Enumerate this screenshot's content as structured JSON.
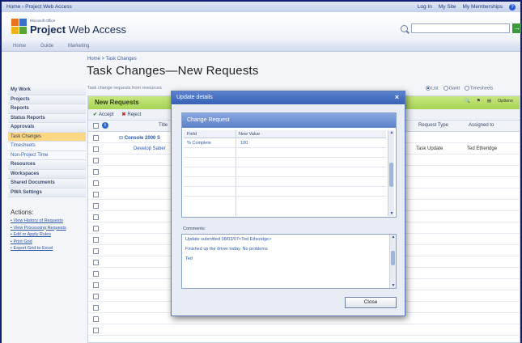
{
  "topbar": {
    "breadcrumb": "Home › Project Web Access",
    "login": "Log In",
    "my_site": "My Site",
    "my_memberships": "My Memberships"
  },
  "brand": {
    "small": "Microsoft Office",
    "title_bold": "Project",
    "title_rest": " Web Access",
    "logo_colors": [
      "#e8731c",
      "#3a70c6",
      "#f0b21c",
      "#5aa339"
    ]
  },
  "search": {
    "placeholder": "",
    "go_label": "→"
  },
  "nav_tabs": [
    "Home",
    "Guide",
    "Marketing"
  ],
  "page": {
    "breadcrumb": "Home > Task Changes",
    "title": "Task Changes—New Requests",
    "subtitle": "Task change requests from resources"
  },
  "views": {
    "list": "List",
    "gantt": "Gantt",
    "timesheets": "Timesheets"
  },
  "sidebar": {
    "items": [
      {
        "label": "My Work",
        "type": "section"
      },
      {
        "label": "Projects",
        "type": "section"
      },
      {
        "label": "Reports",
        "type": "section"
      },
      {
        "label": "Status Reports",
        "type": "section"
      },
      {
        "label": "Approvals",
        "type": "section"
      },
      {
        "label": "Task Changes",
        "type": "active"
      },
      {
        "label": "Timesheets",
        "type": "sub"
      },
      {
        "label": "Non-Project Time",
        "type": "sub"
      },
      {
        "label": "Resources",
        "type": "section"
      },
      {
        "label": "Workspaces",
        "type": "section"
      },
      {
        "label": "Shared Documents",
        "type": "section"
      },
      {
        "label": "PWA Settings",
        "type": "section"
      }
    ],
    "actions_title": "Actions:",
    "actions": [
      "View History of Requests",
      "View Processing Requests",
      "Edit or Apply Rules",
      "Print Grid",
      "Export Grid to Excel"
    ]
  },
  "grid": {
    "band_title": "New Requests",
    "band_options": "Options",
    "toolbar": {
      "accept": "Accept",
      "reject": "Reject"
    },
    "columns": {
      "title": "Title",
      "request_type": "Request Type",
      "assigned_to": "Assigned to"
    },
    "rows": [
      {
        "title": "Console 2000 S",
        "bold": true,
        "request_type": "",
        "assigned_to": ""
      },
      {
        "title": "Develop Saber",
        "bold": false,
        "request_type": "Task Update",
        "assigned_to": "Ted Etheridge"
      }
    ]
  },
  "dialog": {
    "title": "Update details",
    "close_glyph": "×",
    "section_title": "Change Request",
    "columns": {
      "field": "Field",
      "new_value": "New Value"
    },
    "rows": [
      {
        "field": "% Complete",
        "value": "100"
      }
    ],
    "comments_label": "Comments:",
    "comments": [
      "Update submitted 08/03/07<Ted Etheridge>",
      "Finished up the driver today.  No problems",
      "Ted"
    ],
    "close_button": "Close"
  }
}
